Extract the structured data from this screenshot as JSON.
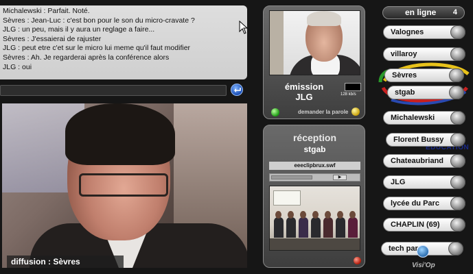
{
  "chat": {
    "messages": [
      "Michalewski : Parfait. Noté.",
      "Sèvres : Jean-Luc : c'est bon pour le son du micro-cravate ?",
      "JLG : un peu, mais il y aura un reglage a faire...",
      "Sèvres : J'essaierai de rajuster",
      "JLG : peut etre c'et sur le micro lui meme qu'il faut modifier",
      "Sèvres : Ah. Je regarderai après la conférence alors",
      "JLG : oui"
    ],
    "input_value": ""
  },
  "broadcast": {
    "label": "diffusion :",
    "source": "Sèvres"
  },
  "emission": {
    "title": "émission",
    "name": "JLG",
    "bitrate": "128 kb/s",
    "ask_floor": "demander la parole"
  },
  "reception": {
    "title": "réception",
    "name": "stgab",
    "file": "eeeclipbrux.swf"
  },
  "online": {
    "label": "en ligne",
    "count": "4"
  },
  "users": [
    {
      "name": "Valognes"
    },
    {
      "name": "villaroy"
    },
    {
      "name": "Sèvres"
    },
    {
      "name": "stgab"
    },
    {
      "name": "Michalewski"
    },
    {
      "name": "Florent Bussy"
    },
    {
      "name": "Chateaubriand"
    },
    {
      "name": "JLG"
    },
    {
      "name": "lycée du Parc"
    },
    {
      "name": "CHAPLIN (69)"
    },
    {
      "name": "tech parc"
    }
  ],
  "branding": {
    "app": "Visi'Op",
    "watermark": "EDUCATION"
  },
  "colors": {
    "background": "#161616",
    "led_green": "#1c9a12",
    "led_yellow": "#c9a10a",
    "led_red": "#b01a0a",
    "send_blue": "#1b4fb6"
  }
}
